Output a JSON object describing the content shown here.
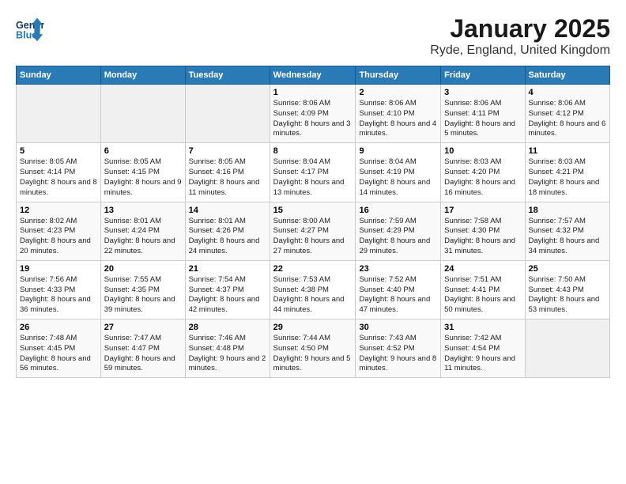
{
  "logo": {
    "line1": "General",
    "line2": "Blue"
  },
  "title": "January 2025",
  "subtitle": "Ryde, England, United Kingdom",
  "days_of_week": [
    "Sunday",
    "Monday",
    "Tuesday",
    "Wednesday",
    "Thursday",
    "Friday",
    "Saturday"
  ],
  "weeks": [
    [
      {
        "day": "",
        "info": ""
      },
      {
        "day": "",
        "info": ""
      },
      {
        "day": "",
        "info": ""
      },
      {
        "day": "1",
        "info": "Sunrise: 8:06 AM\nSunset: 4:09 PM\nDaylight: 8 hours and 3 minutes."
      },
      {
        "day": "2",
        "info": "Sunrise: 8:06 AM\nSunset: 4:10 PM\nDaylight: 8 hours and 4 minutes."
      },
      {
        "day": "3",
        "info": "Sunrise: 8:06 AM\nSunset: 4:11 PM\nDaylight: 8 hours and 5 minutes."
      },
      {
        "day": "4",
        "info": "Sunrise: 8:06 AM\nSunset: 4:12 PM\nDaylight: 8 hours and 6 minutes."
      }
    ],
    [
      {
        "day": "5",
        "info": "Sunrise: 8:05 AM\nSunset: 4:14 PM\nDaylight: 8 hours and 8 minutes."
      },
      {
        "day": "6",
        "info": "Sunrise: 8:05 AM\nSunset: 4:15 PM\nDaylight: 8 hours and 9 minutes."
      },
      {
        "day": "7",
        "info": "Sunrise: 8:05 AM\nSunset: 4:16 PM\nDaylight: 8 hours and 11 minutes."
      },
      {
        "day": "8",
        "info": "Sunrise: 8:04 AM\nSunset: 4:17 PM\nDaylight: 8 hours and 13 minutes."
      },
      {
        "day": "9",
        "info": "Sunrise: 8:04 AM\nSunset: 4:19 PM\nDaylight: 8 hours and 14 minutes."
      },
      {
        "day": "10",
        "info": "Sunrise: 8:03 AM\nSunset: 4:20 PM\nDaylight: 8 hours and 16 minutes."
      },
      {
        "day": "11",
        "info": "Sunrise: 8:03 AM\nSunset: 4:21 PM\nDaylight: 8 hours and 18 minutes."
      }
    ],
    [
      {
        "day": "12",
        "info": "Sunrise: 8:02 AM\nSunset: 4:23 PM\nDaylight: 8 hours and 20 minutes."
      },
      {
        "day": "13",
        "info": "Sunrise: 8:01 AM\nSunset: 4:24 PM\nDaylight: 8 hours and 22 minutes."
      },
      {
        "day": "14",
        "info": "Sunrise: 8:01 AM\nSunset: 4:26 PM\nDaylight: 8 hours and 24 minutes."
      },
      {
        "day": "15",
        "info": "Sunrise: 8:00 AM\nSunset: 4:27 PM\nDaylight: 8 hours and 27 minutes."
      },
      {
        "day": "16",
        "info": "Sunrise: 7:59 AM\nSunset: 4:29 PM\nDaylight: 8 hours and 29 minutes."
      },
      {
        "day": "17",
        "info": "Sunrise: 7:58 AM\nSunset: 4:30 PM\nDaylight: 8 hours and 31 minutes."
      },
      {
        "day": "18",
        "info": "Sunrise: 7:57 AM\nSunset: 4:32 PM\nDaylight: 8 hours and 34 minutes."
      }
    ],
    [
      {
        "day": "19",
        "info": "Sunrise: 7:56 AM\nSunset: 4:33 PM\nDaylight: 8 hours and 36 minutes."
      },
      {
        "day": "20",
        "info": "Sunrise: 7:55 AM\nSunset: 4:35 PM\nDaylight: 8 hours and 39 minutes."
      },
      {
        "day": "21",
        "info": "Sunrise: 7:54 AM\nSunset: 4:37 PM\nDaylight: 8 hours and 42 minutes."
      },
      {
        "day": "22",
        "info": "Sunrise: 7:53 AM\nSunset: 4:38 PM\nDaylight: 8 hours and 44 minutes."
      },
      {
        "day": "23",
        "info": "Sunrise: 7:52 AM\nSunset: 4:40 PM\nDaylight: 8 hours and 47 minutes."
      },
      {
        "day": "24",
        "info": "Sunrise: 7:51 AM\nSunset: 4:41 PM\nDaylight: 8 hours and 50 minutes."
      },
      {
        "day": "25",
        "info": "Sunrise: 7:50 AM\nSunset: 4:43 PM\nDaylight: 8 hours and 53 minutes."
      }
    ],
    [
      {
        "day": "26",
        "info": "Sunrise: 7:48 AM\nSunset: 4:45 PM\nDaylight: 8 hours and 56 minutes."
      },
      {
        "day": "27",
        "info": "Sunrise: 7:47 AM\nSunset: 4:47 PM\nDaylight: 8 hours and 59 minutes."
      },
      {
        "day": "28",
        "info": "Sunrise: 7:46 AM\nSunset: 4:48 PM\nDaylight: 9 hours and 2 minutes."
      },
      {
        "day": "29",
        "info": "Sunrise: 7:44 AM\nSunset: 4:50 PM\nDaylight: 9 hours and 5 minutes."
      },
      {
        "day": "30",
        "info": "Sunrise: 7:43 AM\nSunset: 4:52 PM\nDaylight: 9 hours and 8 minutes."
      },
      {
        "day": "31",
        "info": "Sunrise: 7:42 AM\nSunset: 4:54 PM\nDaylight: 9 hours and 11 minutes."
      },
      {
        "day": "",
        "info": ""
      }
    ]
  ]
}
